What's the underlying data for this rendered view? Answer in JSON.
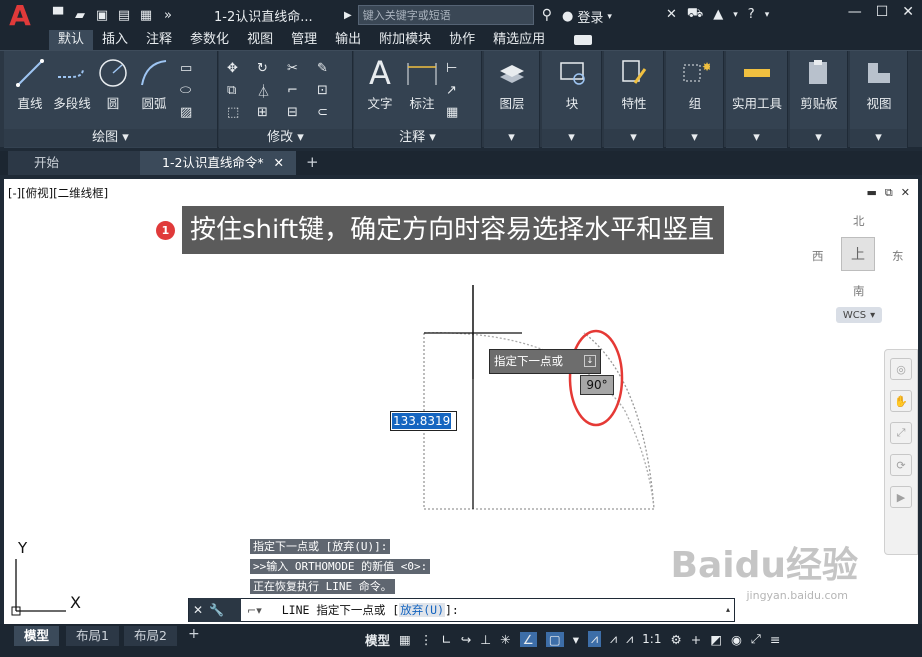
{
  "titlebar": {
    "app_logo": "A",
    "doc_title": "1-2认识直线命...",
    "search_placeholder": "键入关键字或短语",
    "login_label": "登录"
  },
  "ribbon_tabs": [
    "默认",
    "插入",
    "注释",
    "参数化",
    "视图",
    "管理",
    "输出",
    "附加模块",
    "协作",
    "精选应用"
  ],
  "ribbon_tools": {
    "line": "直线",
    "polyline": "多段线",
    "circle": "圆",
    "arc": "圆弧",
    "text": "文字",
    "dimension": "标注",
    "layer": "图层",
    "block": "块",
    "properties": "特性",
    "group": "组",
    "utilities": "实用工具",
    "clipboard": "剪贴板",
    "view": "视图"
  },
  "ribbon_groups": {
    "draw": "绘图",
    "modify": "修改",
    "annotation": "注释"
  },
  "file_tabs": {
    "start": "开始",
    "drawing": "1-2认识直线命令*"
  },
  "canvas": {
    "viewport_label": "[-][俯视][二维线框]",
    "callout_number": "1",
    "callout_text": "按住shift键，确定方向时容易选择水平和竖直",
    "prompt_tip": "指定下一点或",
    "angle": "90°",
    "length_value": "133.8319"
  },
  "viewcube": {
    "north": "北",
    "south": "南",
    "west": "西",
    "east": "东",
    "face": "上",
    "wcs": "WCS"
  },
  "ucs": {
    "x": "X",
    "y": "Y"
  },
  "command_history": [
    "指定下一点或 [放弃(U)]:",
    ">>输入 ORTHOMODE 的新值 <0>:",
    "正在恢复执行 LINE 命令。"
  ],
  "command_line": {
    "prefix": "LINE 指定下一点或 [",
    "option": "放弃(U)",
    "suffix": "]:"
  },
  "layout_tabs": {
    "model": "模型",
    "layout1": "布局1",
    "layout2": "布局2"
  },
  "statusbar": {
    "model_label": "模型",
    "scale": "1:1"
  },
  "watermark": {
    "brand": "Baidu经验",
    "url": "jingyan.baidu.com"
  }
}
